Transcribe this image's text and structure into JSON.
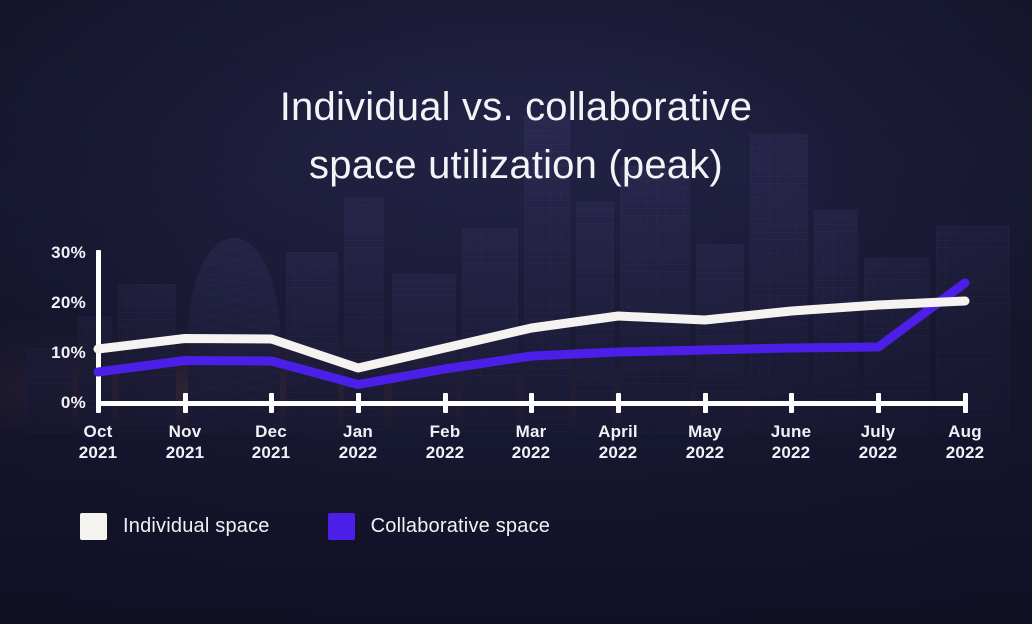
{
  "background": {
    "base_color": "#191a34",
    "description": "dark navy city skyline photo at dusk"
  },
  "title": "Individual vs. collaborative\nspace utilization (peak)",
  "y_axis": {
    "ticks": [
      "0%",
      "10%",
      "20%",
      "30%"
    ],
    "tick_values": [
      0,
      10,
      20,
      30
    ]
  },
  "x_axis": {
    "ticks": [
      "Oct\n2021",
      "Nov\n2021",
      "Dec\n2021",
      "Jan\n2022",
      "Feb\n2022",
      "Mar\n2022",
      "April\n2022",
      "May\n2022",
      "June\n2022",
      "July\n2022",
      "Aug\n2022"
    ]
  },
  "legend": {
    "items": [
      {
        "label": "Individual space",
        "color": "#f4f3ef"
      },
      {
        "label": "Collaborative space",
        "color": "#4c1fe8"
      }
    ]
  },
  "colors": {
    "individual": "#f4f3ef",
    "collaborative": "#4c1fe8",
    "axis": "#ffffff",
    "text": "#f2f1f7",
    "background": "#191a34"
  },
  "chart_data": {
    "type": "line",
    "title": "Individual vs. collaborative space utilization (peak)",
    "xlabel": "",
    "ylabel": "",
    "ylim": [
      0,
      30
    ],
    "grid": false,
    "legend_position": "bottom-left",
    "y_tick_format": "percent",
    "categories": [
      "Oct 2021",
      "Nov 2021",
      "Dec 2021",
      "Jan 2022",
      "Feb 2022",
      "Mar 2022",
      "April 2022",
      "May 2022",
      "June 2022",
      "July 2022",
      "Aug 2022"
    ],
    "series": [
      {
        "name": "Individual space",
        "color": "#f4f3ef",
        "values": [
          10.8,
          12.9,
          12.8,
          7.0,
          11.0,
          15.0,
          17.4,
          16.6,
          18.4,
          19.6,
          20.4
        ]
      },
      {
        "name": "Collaborative space",
        "color": "#4c1fe8",
        "values": [
          6.2,
          8.5,
          8.4,
          3.7,
          6.8,
          9.4,
          10.2,
          10.6,
          11.0,
          11.2,
          24.0
        ]
      }
    ]
  }
}
